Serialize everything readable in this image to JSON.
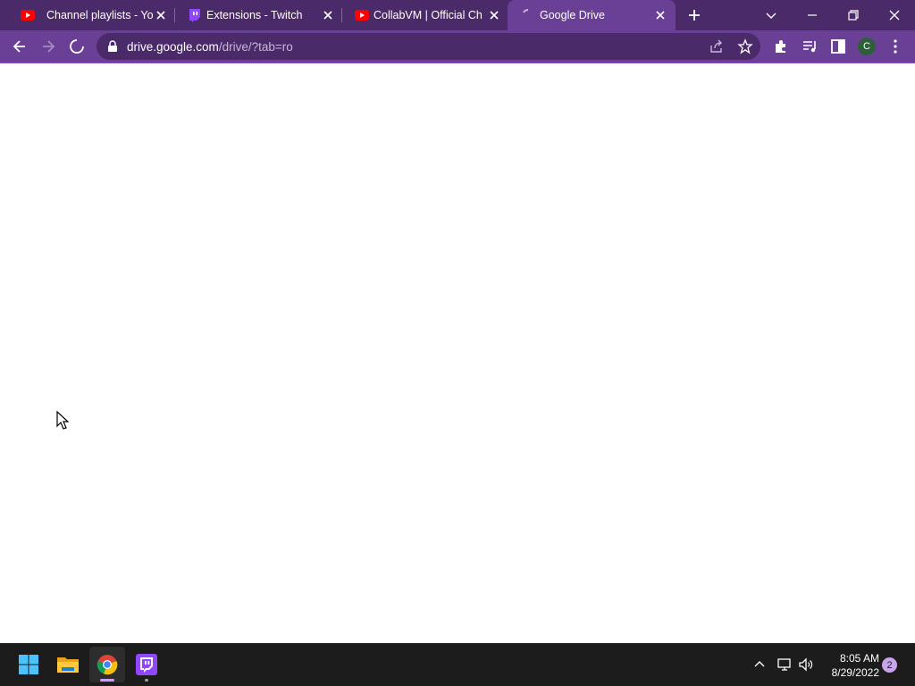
{
  "browser": {
    "tabs": [
      {
        "title": "Channel playlists - YouTube",
        "favicon": "youtube-icon"
      },
      {
        "title": "Extensions - Twitch",
        "favicon": "twitch-icon"
      },
      {
        "title": "CollabVM | Official Channel",
        "favicon": "youtube-icon"
      },
      {
        "title": "Google Drive",
        "favicon": "loading-spinner-icon"
      }
    ],
    "active_tab_index": 3,
    "url_host": "drive.google.com",
    "url_path": "/drive/?tab=ro",
    "profile_initial": "C"
  },
  "taskbar": {
    "apps": [
      {
        "name": "Start",
        "icon": "windows-start-icon"
      },
      {
        "name": "File Explorer",
        "icon": "file-explorer-icon"
      },
      {
        "name": "Google Chrome",
        "icon": "chrome-icon"
      },
      {
        "name": "Twitch",
        "icon": "twitch-icon"
      }
    ],
    "time": "8:05 AM",
    "date": "8/29/2022",
    "notification_count": "2"
  },
  "colors": {
    "tabstrip": "#4a2a68",
    "toolbar": "#6a3f96",
    "accent": "#8a4ec8"
  }
}
